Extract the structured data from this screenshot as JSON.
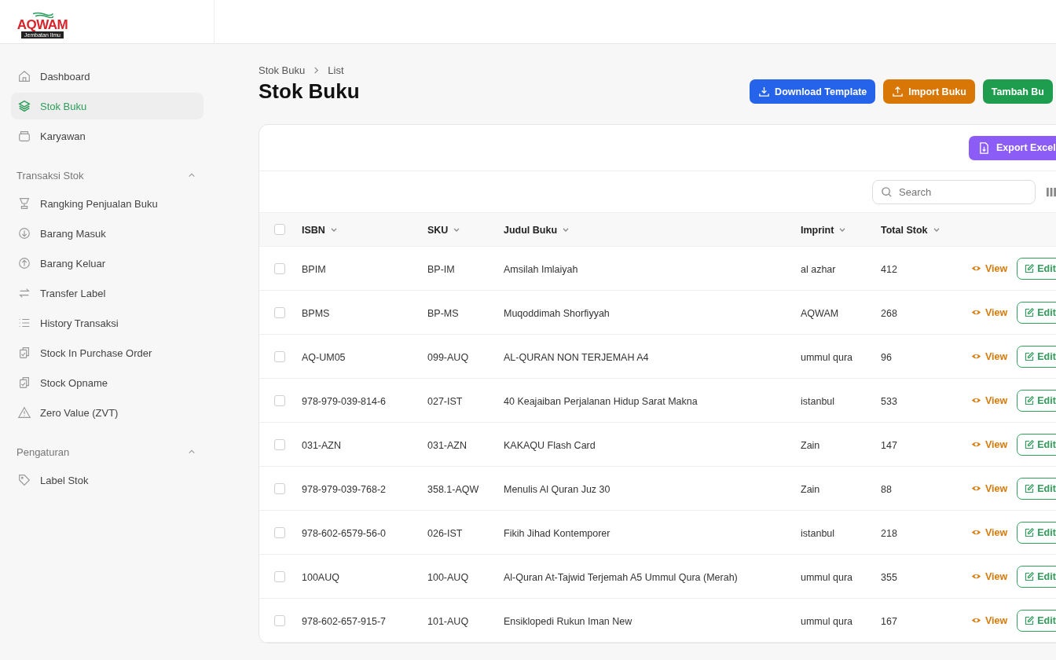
{
  "logo": {
    "name": "AQWAM",
    "tagline": "Jembatan Ilmu"
  },
  "sidebar": {
    "items": [
      {
        "label": "Dashboard",
        "selected": false
      },
      {
        "label": "Stok Buku",
        "selected": true
      },
      {
        "label": "Karyawan",
        "selected": false
      }
    ],
    "sections": [
      {
        "title": "Transaksi Stok",
        "expanded": true,
        "items": [
          {
            "label": "Rangking Penjualan Buku",
            "selected": false
          },
          {
            "label": "Barang Masuk",
            "selected": false
          },
          {
            "label": "Barang Keluar",
            "selected": false
          },
          {
            "label": "Transfer Label",
            "selected": false
          },
          {
            "label": "History Transaksi",
            "selected": false
          },
          {
            "label": "Stock In Purchase Order",
            "selected": false
          },
          {
            "label": "Stock Opname",
            "selected": false
          },
          {
            "label": "Zero Value (ZVT)",
            "selected": false
          }
        ]
      },
      {
        "title": "Pengaturan",
        "expanded": true,
        "items": [
          {
            "label": "Label Stok",
            "selected": false
          }
        ]
      }
    ]
  },
  "breadcrumb": [
    "Stok Buku",
    "List"
  ],
  "page_title": "Stok Buku",
  "header_buttons": [
    "Download Template",
    "Import Buku",
    "Tambah Bu"
  ],
  "export_button": "Export Excel",
  "search": {
    "placeholder": "Search"
  },
  "table": {
    "select_all_checked": false,
    "columns": [
      "ISBN",
      "SKU",
      "Judul Buku",
      "Imprint",
      "Total Stok"
    ],
    "rows": [
      {
        "checked": false,
        "cells": [
          "BPIM",
          "BP-IM",
          "Amsilah Imlaiyah",
          "al azhar",
          "412"
        ],
        "actions": [
          "View",
          "Edit"
        ]
      },
      {
        "checked": false,
        "cells": [
          "BPMS",
          "BP-MS",
          "Muqoddimah Shorfiyyah",
          "AQWAM",
          "268"
        ],
        "actions": [
          "View",
          "Edit"
        ]
      },
      {
        "checked": false,
        "cells": [
          "AQ-UM05",
          "099-AUQ",
          "AL-QURAN NON TERJEMAH A4",
          "ummul qura",
          "96"
        ],
        "actions": [
          "View",
          "Edit"
        ]
      },
      {
        "checked": false,
        "cells": [
          "978-979-039-814-6",
          "027-IST",
          "40 Keajaiban Perjalanan Hidup Sarat Makna",
          "istanbul",
          "533"
        ],
        "actions": [
          "View",
          "Edit"
        ]
      },
      {
        "checked": false,
        "cells": [
          "031-AZN",
          "031-AZN",
          "KAKAQU Flash Card",
          "Zain",
          "147"
        ],
        "actions": [
          "View",
          "Edit"
        ]
      },
      {
        "checked": false,
        "cells": [
          "978-979-039-768-2",
          "358.1-AQW",
          "Menulis Al Quran Juz 30",
          "Zain",
          "88"
        ],
        "actions": [
          "View",
          "Edit"
        ]
      },
      {
        "checked": false,
        "cells": [
          "978-602-6579-56-0",
          "026-IST",
          "Fikih Jihad Kontemporer",
          "istanbul",
          "218"
        ],
        "actions": [
          "View",
          "Edit"
        ]
      },
      {
        "checked": false,
        "cells": [
          "100AUQ",
          "100-AUQ",
          "Al-Quran At-Tajwid Terjemah A5 Ummul Qura (Merah)",
          "ummul qura",
          "355"
        ],
        "actions": [
          "View",
          "Edit"
        ]
      },
      {
        "checked": false,
        "cells": [
          "978-602-657-915-7",
          "101-AUQ",
          "Ensiklopedi Rukun Iman New",
          "ummul qura",
          "167"
        ],
        "actions": [
          "View",
          "Edit"
        ]
      }
    ]
  }
}
